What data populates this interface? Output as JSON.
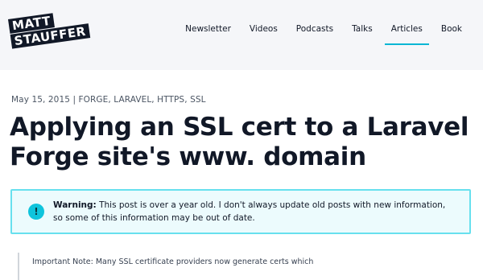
{
  "header": {
    "logo": {
      "line1": "MATT",
      "line2": "STAUFFER"
    },
    "nav": [
      {
        "label": "Newsletter",
        "active": false
      },
      {
        "label": "Videos",
        "active": false
      },
      {
        "label": "Podcasts",
        "active": false
      },
      {
        "label": "Talks",
        "active": false
      },
      {
        "label": "Articles",
        "active": true
      },
      {
        "label": "Book",
        "active": false
      }
    ]
  },
  "post": {
    "meta": "May 15, 2015  |  FORGE, LARAVEL, HTTPS, SSL",
    "title": "Applying an SSL cert to a Laravel Forge site's www. domain",
    "warning": {
      "icon": "!",
      "label": "Warning:",
      "text": "This post is over a year old. I don't always update old posts with new information, so some of this information may be out of date."
    },
    "note": "Important Note: Many SSL certificate providers now generate certs which"
  },
  "colors": {
    "accent": "#06b6d4",
    "warning_bg": "#ecfbfd",
    "warning_border": "#67e0ee"
  }
}
